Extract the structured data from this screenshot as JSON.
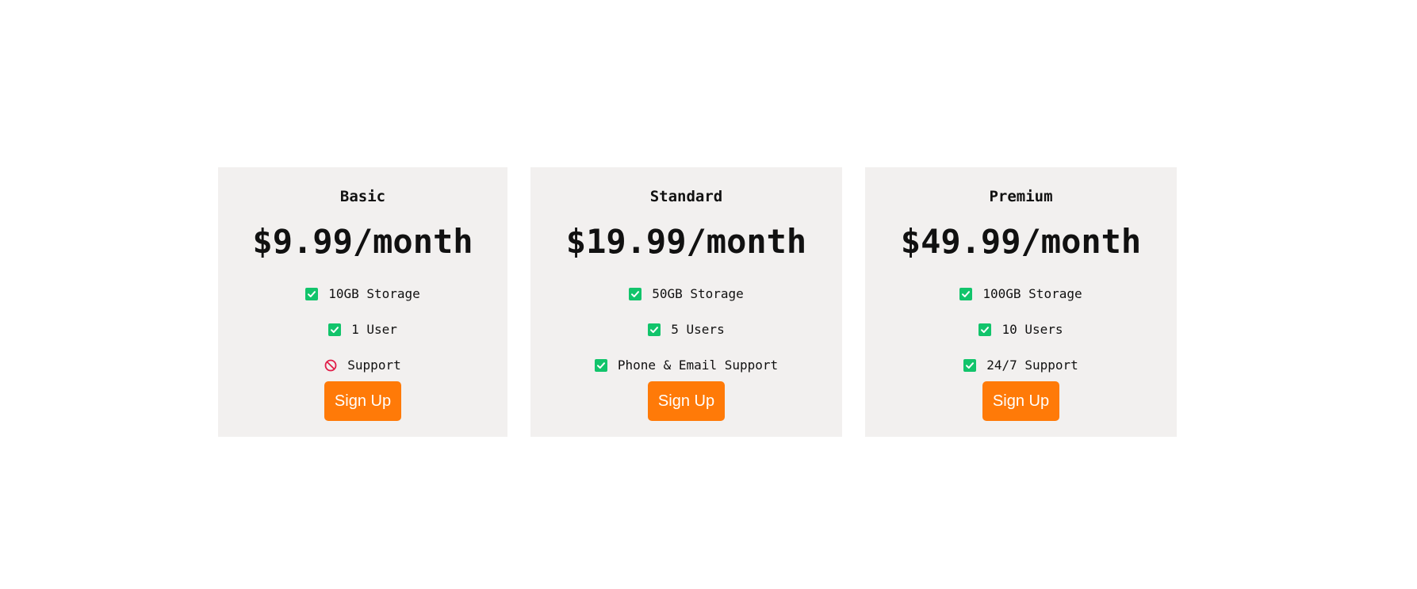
{
  "colors": {
    "card_background": "#f2f0ef",
    "button_background": "#ff7a08",
    "button_text": "#ffffff",
    "check_green": "#12c46b",
    "ban_red": "#e11d48"
  },
  "plans": [
    {
      "name": "Basic",
      "price": "$9.99/month",
      "features": [
        {
          "label": "10GB Storage",
          "icon": "check-square-icon",
          "included": true
        },
        {
          "label": "1 User",
          "icon": "check-square-icon",
          "included": true
        },
        {
          "label": "Support",
          "icon": "ban-icon",
          "included": false
        }
      ],
      "cta": "Sign Up"
    },
    {
      "name": "Standard",
      "price": "$19.99/month",
      "features": [
        {
          "label": "50GB Storage",
          "icon": "check-square-icon",
          "included": true
        },
        {
          "label": "5 Users",
          "icon": "check-square-icon",
          "included": true
        },
        {
          "label": "Phone & Email Support",
          "icon": "check-square-icon",
          "included": true
        }
      ],
      "cta": "Sign Up"
    },
    {
      "name": "Premium",
      "price": "$49.99/month",
      "features": [
        {
          "label": "100GB Storage",
          "icon": "check-square-icon",
          "included": true
        },
        {
          "label": "10 Users",
          "icon": "check-square-icon",
          "included": true
        },
        {
          "label": "24/7 Support",
          "icon": "check-square-icon",
          "included": true
        }
      ],
      "cta": "Sign Up"
    }
  ]
}
